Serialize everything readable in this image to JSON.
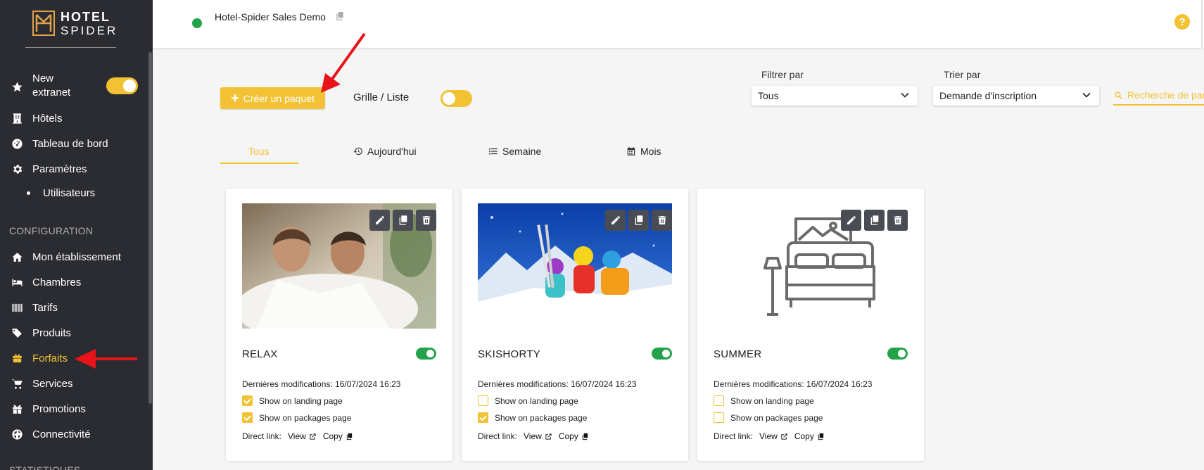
{
  "brand": {
    "line1": "HOTEL",
    "line2": "SPIDER"
  },
  "sidebar": {
    "new_extranet_label": "New extranet",
    "items_top": [
      {
        "label": "Hôtels",
        "icon": "building-icon"
      },
      {
        "label": "Tableau de bord",
        "icon": "dashboard-icon"
      },
      {
        "label": "Paramètres",
        "icon": "gear-icon"
      }
    ],
    "sub_item": "Utilisateurs",
    "section_config": "CONFIGURATION",
    "items_config": [
      {
        "label": "Mon établissement",
        "icon": "home-icon"
      },
      {
        "label": "Chambres",
        "icon": "bed-icon"
      },
      {
        "label": "Tarifs",
        "icon": "barcode-icon"
      },
      {
        "label": "Produits",
        "icon": "tags-icon"
      },
      {
        "label": "Forfaits",
        "icon": "package-icon",
        "active": true
      },
      {
        "label": "Services",
        "icon": "cart-icon"
      },
      {
        "label": "Promotions",
        "icon": "gift-icon"
      },
      {
        "label": "Connectivité",
        "icon": "globe-icon"
      }
    ],
    "section_stats": "STATISTIQUES"
  },
  "topbar": {
    "hotel_name": "Hotel-Spider Sales Demo",
    "help": "?"
  },
  "toolbar": {
    "create_label": "Créer un paquet",
    "grid_list_label": "Grille / Liste",
    "filter_label": "Filtrer par",
    "filter_value": "Tous",
    "sort_label": "Trier par",
    "sort_value": "Demande d'inscription",
    "search_placeholder": "Recherche de paquet"
  },
  "tabs": [
    {
      "label": "Tous",
      "active": true
    },
    {
      "label": "Aujourd'hui",
      "icon": "history-icon"
    },
    {
      "label": "Semaine",
      "icon": "list-icon"
    },
    {
      "label": "Mois",
      "icon": "calendar-icon"
    }
  ],
  "cards": [
    {
      "title": "RELAX",
      "image": "spa-couple-photo",
      "active": true,
      "modified_label": "Dernières modifications: 16/07/2024 16:23",
      "landing_label": "Show on landing page",
      "landing_checked": true,
      "packages_label": "Show on packages page",
      "packages_checked": true,
      "direct_link_label": "Direct link:",
      "view_label": "View",
      "copy_label": "Copy"
    },
    {
      "title": "SKISHORTY",
      "image": "ski-group-photo",
      "active": true,
      "modified_label": "Dernières modifications: 16/07/2024 16:23",
      "landing_label": "Show on landing page",
      "landing_checked": false,
      "packages_label": "Show on packages page",
      "packages_checked": true,
      "direct_link_label": "Direct link:",
      "view_label": "View",
      "copy_label": "Copy"
    },
    {
      "title": "SUMMER",
      "image": "room-placeholder-icon",
      "active": true,
      "modified_label": "Dernières modifications: 16/07/2024 16:23",
      "landing_label": "Show on landing page",
      "landing_checked": false,
      "packages_label": "Show on packages page",
      "packages_checked": false,
      "direct_link_label": "Direct link:",
      "view_label": "View",
      "copy_label": "Copy"
    }
  ],
  "colors": {
    "accent": "#f2c234",
    "sidebar_bg": "#2b2c31",
    "active_green": "#22a34a",
    "annotation_red": "#e8141a"
  }
}
